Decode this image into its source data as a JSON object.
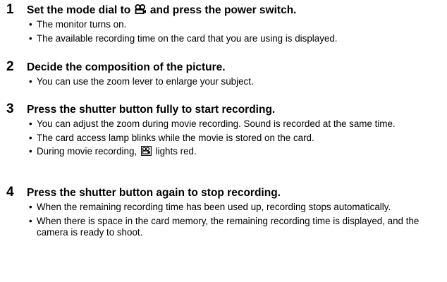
{
  "steps": [
    {
      "number": "1",
      "heading_before": "Set the mode dial to",
      "icon": "movie-mode-icon",
      "heading_after": "and press the power switch.",
      "bullets": [
        "The monitor turns on.",
        "The available recording time on the card that you are using is displayed."
      ]
    },
    {
      "number": "2",
      "heading": "Decide the composition of the picture.",
      "bullets": [
        "You can use the zoom lever to enlarge your subject."
      ]
    },
    {
      "number": "3",
      "heading": "Press the shutter button fully to start recording.",
      "bullets": [
        "You can adjust the zoom during movie recording. Sound is recorded at the same time.",
        "The card access lamp blinks while the movie is stored on the card."
      ],
      "bullet_with_icon": {
        "before": "During movie recording,",
        "icon": "movie-indicator-icon",
        "after": "lights red."
      }
    },
    {
      "number": "4",
      "heading": "Press the shutter button again to stop recording.",
      "bullets": [
        "When the remaining recording time has been used up, recording stops automatically.",
        "When there is space in the card memory, the remaining recording time is displayed, and the camera is ready to shoot."
      ]
    }
  ],
  "bullet_char": "•"
}
